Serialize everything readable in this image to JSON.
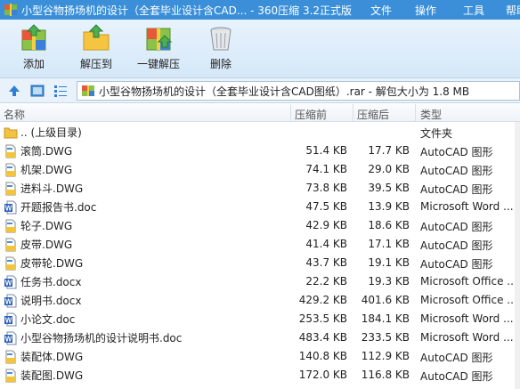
{
  "window": {
    "title": "小型谷物扬场机的设计（全套毕业设计含CAD... - 360压缩 3.2正式版"
  },
  "menu": [
    "文件",
    "操作",
    "工具",
    "帮助"
  ],
  "toolbar": {
    "add": "添加",
    "extract_to": "解压到",
    "one_click_extract": "一键解压",
    "delete": "删除"
  },
  "address": {
    "path": "小型谷物扬场机的设计（全套毕业设计含CAD图纸）.rar - 解包大小为 1.8 MB"
  },
  "columns": {
    "name": "名称",
    "packed": "压缩前",
    "size": "压缩后",
    "type": "类型"
  },
  "files": [
    {
      "name": ".. (上级目录)",
      "packed": "",
      "size": "",
      "type": "文件夹",
      "icon": "folder-icon"
    },
    {
      "name": "滚筒.DWG",
      "packed": "51.4 KB",
      "size": "17.7 KB",
      "type": "AutoCAD 图形",
      "icon": "dwg-icon"
    },
    {
      "name": "机架.DWG",
      "packed": "74.1 KB",
      "size": "29.0 KB",
      "type": "AutoCAD 图形",
      "icon": "dwg-icon"
    },
    {
      "name": "进料斗.DWG",
      "packed": "73.8 KB",
      "size": "39.5 KB",
      "type": "AutoCAD 图形",
      "icon": "dwg-icon"
    },
    {
      "name": "开题报告书.doc",
      "packed": "47.5 KB",
      "size": "13.9 KB",
      "type": "Microsoft Word ...",
      "icon": "word-icon"
    },
    {
      "name": "轮子.DWG",
      "packed": "42.9 KB",
      "size": "18.6 KB",
      "type": "AutoCAD 图形",
      "icon": "dwg-icon"
    },
    {
      "name": "皮带.DWG",
      "packed": "41.4 KB",
      "size": "17.1 KB",
      "type": "AutoCAD 图形",
      "icon": "dwg-icon"
    },
    {
      "name": "皮带轮.DWG",
      "packed": "43.7 KB",
      "size": "19.1 KB",
      "type": "AutoCAD 图形",
      "icon": "dwg-icon"
    },
    {
      "name": "任务书.docx",
      "packed": "22.2 KB",
      "size": "19.3 KB",
      "type": "Microsoft Office ...",
      "icon": "word-icon"
    },
    {
      "name": "说明书.docx",
      "packed": "429.2 KB",
      "size": "401.6 KB",
      "type": "Microsoft Office ...",
      "icon": "word-icon"
    },
    {
      "name": "小论文.doc",
      "packed": "253.5 KB",
      "size": "184.1 KB",
      "type": "Microsoft Word ...",
      "icon": "word-icon"
    },
    {
      "name": "小型谷物扬场机的设计说明书.doc",
      "packed": "483.4 KB",
      "size": "233.5 KB",
      "type": "Microsoft Word ...",
      "icon": "word-icon"
    },
    {
      "name": "装配体.DWG",
      "packed": "140.8 KB",
      "size": "112.9 KB",
      "type": "AutoCAD 图形",
      "icon": "dwg-icon"
    },
    {
      "name": "装配图.DWG",
      "packed": "172.0 KB",
      "size": "116.8 KB",
      "type": "AutoCAD 图形",
      "icon": "dwg-icon"
    }
  ]
}
